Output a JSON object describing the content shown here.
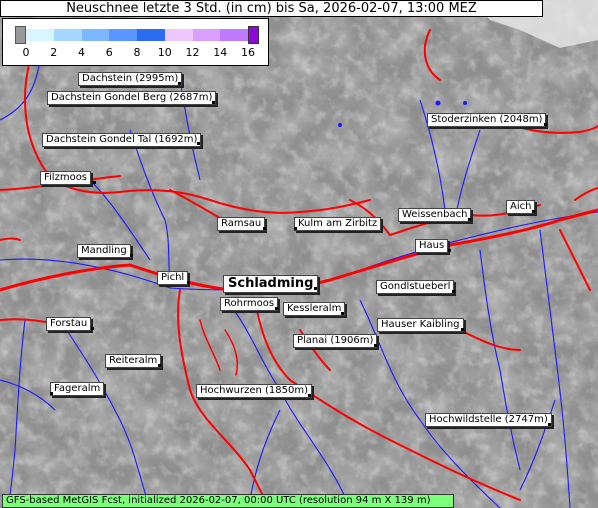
{
  "title": "Neuschnee letzte 3 Std. (in cm) bis Sa, 2026-02-07, 13:00 MEZ",
  "legend": {
    "ticks": [
      "0",
      "2",
      "4",
      "6",
      "8",
      "10",
      "12",
      "14",
      "16"
    ],
    "colors": [
      "#d8f6ff",
      "#a6d8ff",
      "#7cb8ff",
      "#5a96ff",
      "#2c6cf0",
      "#f0c6ff",
      "#d9a0ff",
      "#c07aff",
      "#8a0ad8"
    ]
  },
  "places": [
    {
      "name": "Dachstein (2995m)",
      "label": "Dachstein (2995m)"
    },
    {
      "name": "Dachstein Gondel Berg",
      "label": "Dachstein Gondel Berg (2687m)"
    },
    {
      "name": "Dachstein Gondel Tal",
      "label": "Dachstein Gondel Tal (1692m)"
    },
    {
      "name": "Filzmoos",
      "label": "Filzmoos"
    },
    {
      "name": "Stoderzinken",
      "label": "Stoderzinken (2048m)"
    },
    {
      "name": "Weissenbach",
      "label": "Weissenbach"
    },
    {
      "name": "Aich",
      "label": "Aich"
    },
    {
      "name": "Ramsau",
      "label": "Ramsau"
    },
    {
      "name": "Kulm am Zirbitz",
      "label": "Kulm am Zirbitz"
    },
    {
      "name": "Haus",
      "label": "Haus"
    },
    {
      "name": "Mandling",
      "label": "Mandling"
    },
    {
      "name": "Pichl",
      "label": "Pichl"
    },
    {
      "name": "Schladming",
      "label": "Schladming"
    },
    {
      "name": "Gondlstueberl",
      "label": "Gondlstueberl"
    },
    {
      "name": "Rohrmoos",
      "label": "Rohrmoos"
    },
    {
      "name": "Kesslerlam",
      "label": "Kessleralm"
    },
    {
      "name": "Forstau",
      "label": "Forstau"
    },
    {
      "name": "Hauser Kaibling",
      "label": "Hauser Kaibling"
    },
    {
      "name": "Planai",
      "label": "Planai (1906m)"
    },
    {
      "name": "Reiteralm",
      "label": "Reiteralm"
    },
    {
      "name": "Fageralm",
      "label": "Fageralm"
    },
    {
      "name": "Hochwurzen",
      "label": "Hochwurzen (1850m)"
    },
    {
      "name": "Hochwildstelle",
      "label": "Hochwildstelle (2747m)"
    }
  ],
  "footer": "GFS-based MetGIS Fcst, initialized 2026-02-07, 00:00 UTC  (resolution 94 m X 139 m)"
}
